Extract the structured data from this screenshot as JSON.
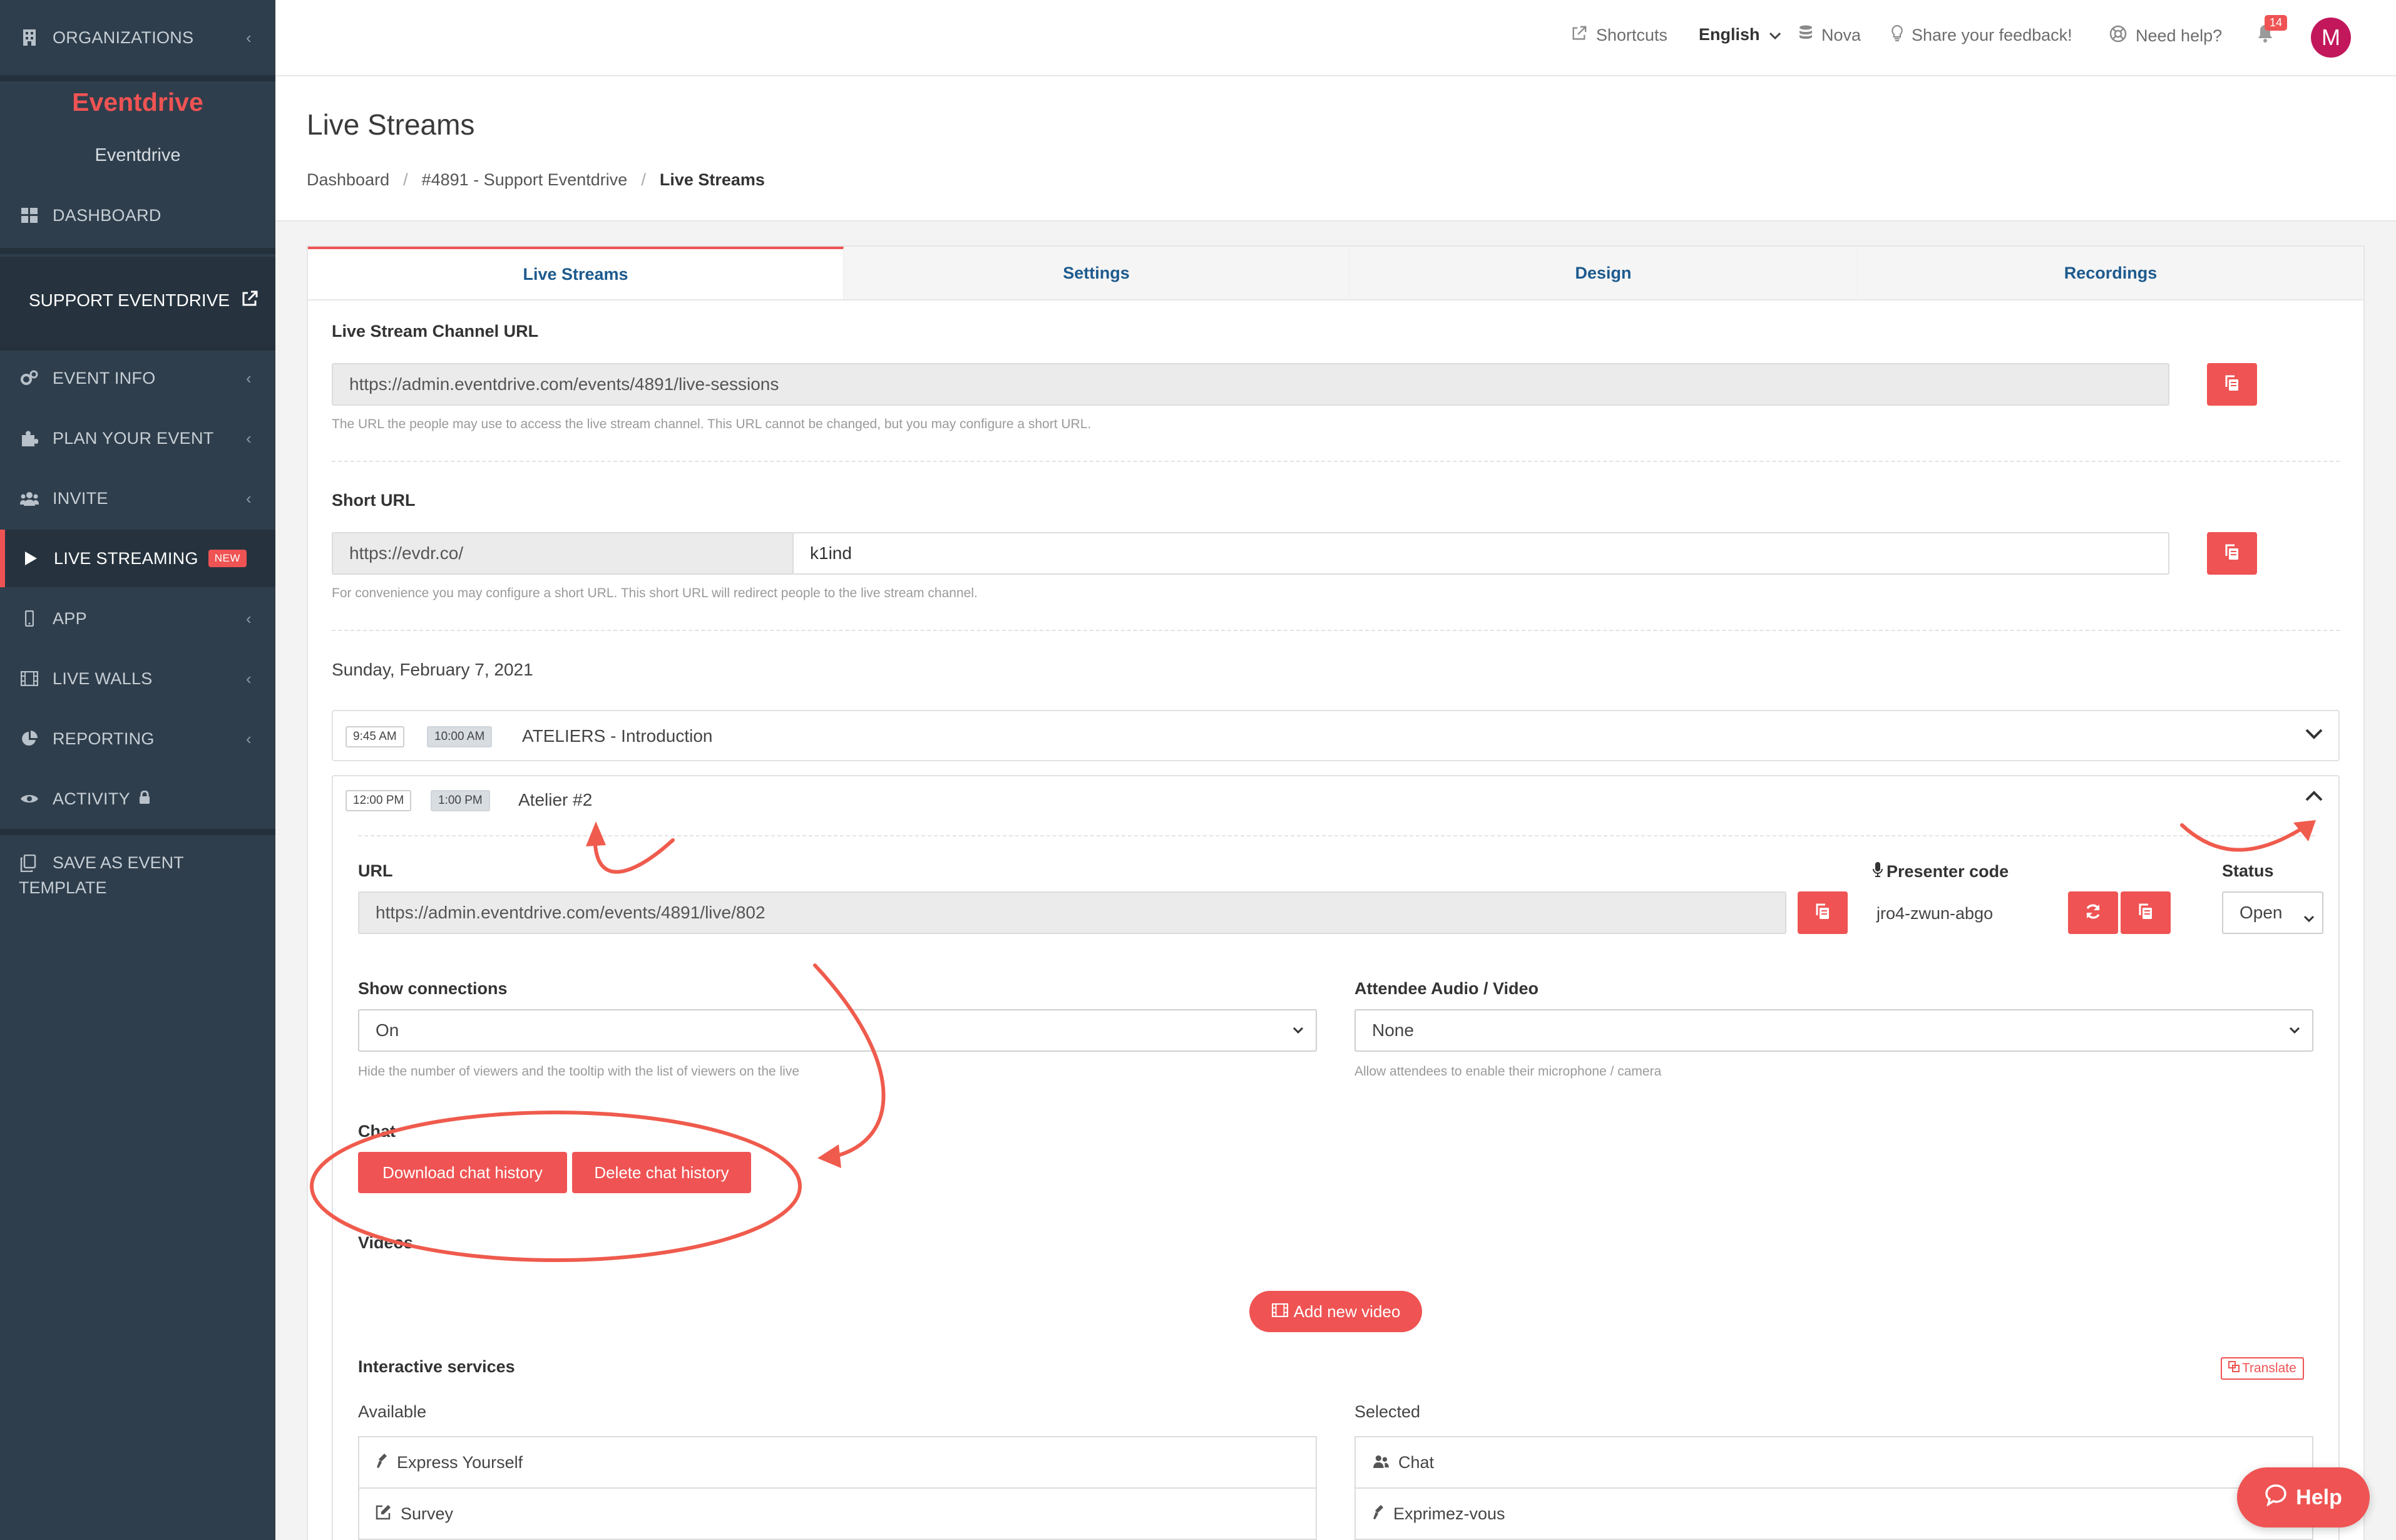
{
  "sidebar": {
    "organizations": "ORGANIZATIONS",
    "brand": "Eventdrive",
    "brand_sub": "Eventdrive",
    "dashboard": "DASHBOARD",
    "support": "SUPPORT EVENTDRIVE",
    "items": [
      {
        "label": "EVENT INFO"
      },
      {
        "label": "PLAN YOUR EVENT"
      },
      {
        "label": "INVITE"
      },
      {
        "label": "LIVE STREAMING",
        "badge": "NEW"
      },
      {
        "label": "APP"
      },
      {
        "label": "LIVE WALLS"
      },
      {
        "label": "REPORTING"
      },
      {
        "label": "ACTIVITY"
      }
    ],
    "template_line1": "SAVE AS EVENT",
    "template_line2": "TEMPLATE"
  },
  "topbar": {
    "shortcuts": "Shortcuts",
    "language": "English",
    "nova": "Nova",
    "feedback": "Share your feedback!",
    "help": "Need help?",
    "notifications": "14",
    "avatar": "M"
  },
  "page": {
    "title": "Live Streams",
    "breadcrumb": [
      "Dashboard",
      "#4891 - Support Eventdrive",
      "Live Streams"
    ]
  },
  "tabs": [
    "Live Streams",
    "Settings",
    "Design",
    "Recordings"
  ],
  "channel": {
    "label": "Live Stream Channel URL",
    "url": "https://admin.eventdrive.com/events/4891/live-sessions",
    "help": "The URL the people may use to access the live stream channel. This URL cannot be changed, but you may configure a short URL."
  },
  "short_url": {
    "label": "Short URL",
    "prefix": "https://evdr.co/",
    "value": "k1ind",
    "help": "For convenience you may configure a short URL. This short URL will redirect people to the live stream channel."
  },
  "date": "Sunday, February 7, 2021",
  "sessions": [
    {
      "start": "9:45 AM",
      "end": "10:00 AM",
      "title": "ATELIERS - Introduction"
    },
    {
      "start": "12:00 PM",
      "end": "1:00 PM",
      "title": "Atelier #2"
    }
  ],
  "detail": {
    "url_label": "URL",
    "url": "https://admin.eventdrive.com/events/4891/live/802",
    "presenter_label": "Presenter code",
    "presenter_code": "jro4-zwun-abgo",
    "status_label": "Status",
    "status": "Open",
    "show_conn_label": "Show connections",
    "show_conn": "On",
    "show_conn_help": "Hide the number of viewers and the tooltip with the list of viewers on the live",
    "av_label": "Attendee Audio / Video",
    "av": "None",
    "av_help": "Allow attendees to enable their microphone / camera",
    "chat_label": "Chat",
    "download_chat": "Download chat history",
    "delete_chat": "Delete chat history",
    "videos_label": "Videos",
    "add_video": "Add new video",
    "interactive_label": "Interactive services",
    "translate": "Translate",
    "available_label": "Available",
    "selected_label": "Selected",
    "available": [
      "Express Yourself",
      "Survey"
    ],
    "selected": [
      "Chat",
      "Exprimez-vous"
    ]
  },
  "help_button": "Help",
  "colors": {
    "accent": "#ef5353",
    "sidebar": "#2f3e4c",
    "link": "#1d5a8e"
  }
}
